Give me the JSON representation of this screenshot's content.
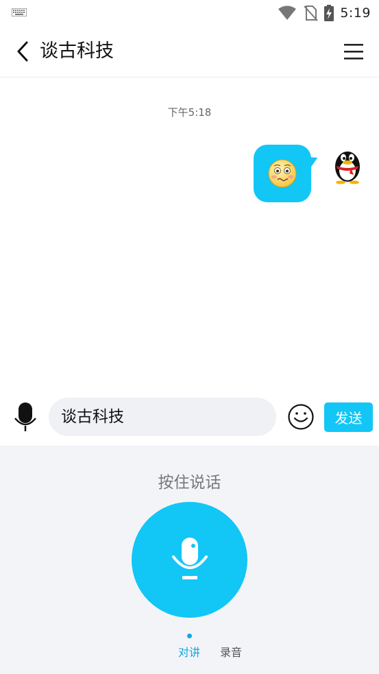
{
  "status_bar": {
    "time": "5:19",
    "icons": [
      "keyboard-icon",
      "wifi-icon",
      "no-sim-icon",
      "battery-charging-icon"
    ]
  },
  "header": {
    "title": "谈古科技"
  },
  "chat": {
    "timestamp": "下午5:18",
    "messages": [
      {
        "sender": "self",
        "content_type": "emoji",
        "emoji": "😳"
      }
    ]
  },
  "input_bar": {
    "text_value": "谈古科技",
    "send_label": "发送"
  },
  "voice_panel": {
    "hold_to_talk_label": "按住说话",
    "tabs": [
      {
        "label": "对讲",
        "active": true
      },
      {
        "label": "录音",
        "active": false
      }
    ]
  },
  "colors": {
    "accent": "#12c6f6",
    "panel_bg": "#f3f4f7"
  }
}
